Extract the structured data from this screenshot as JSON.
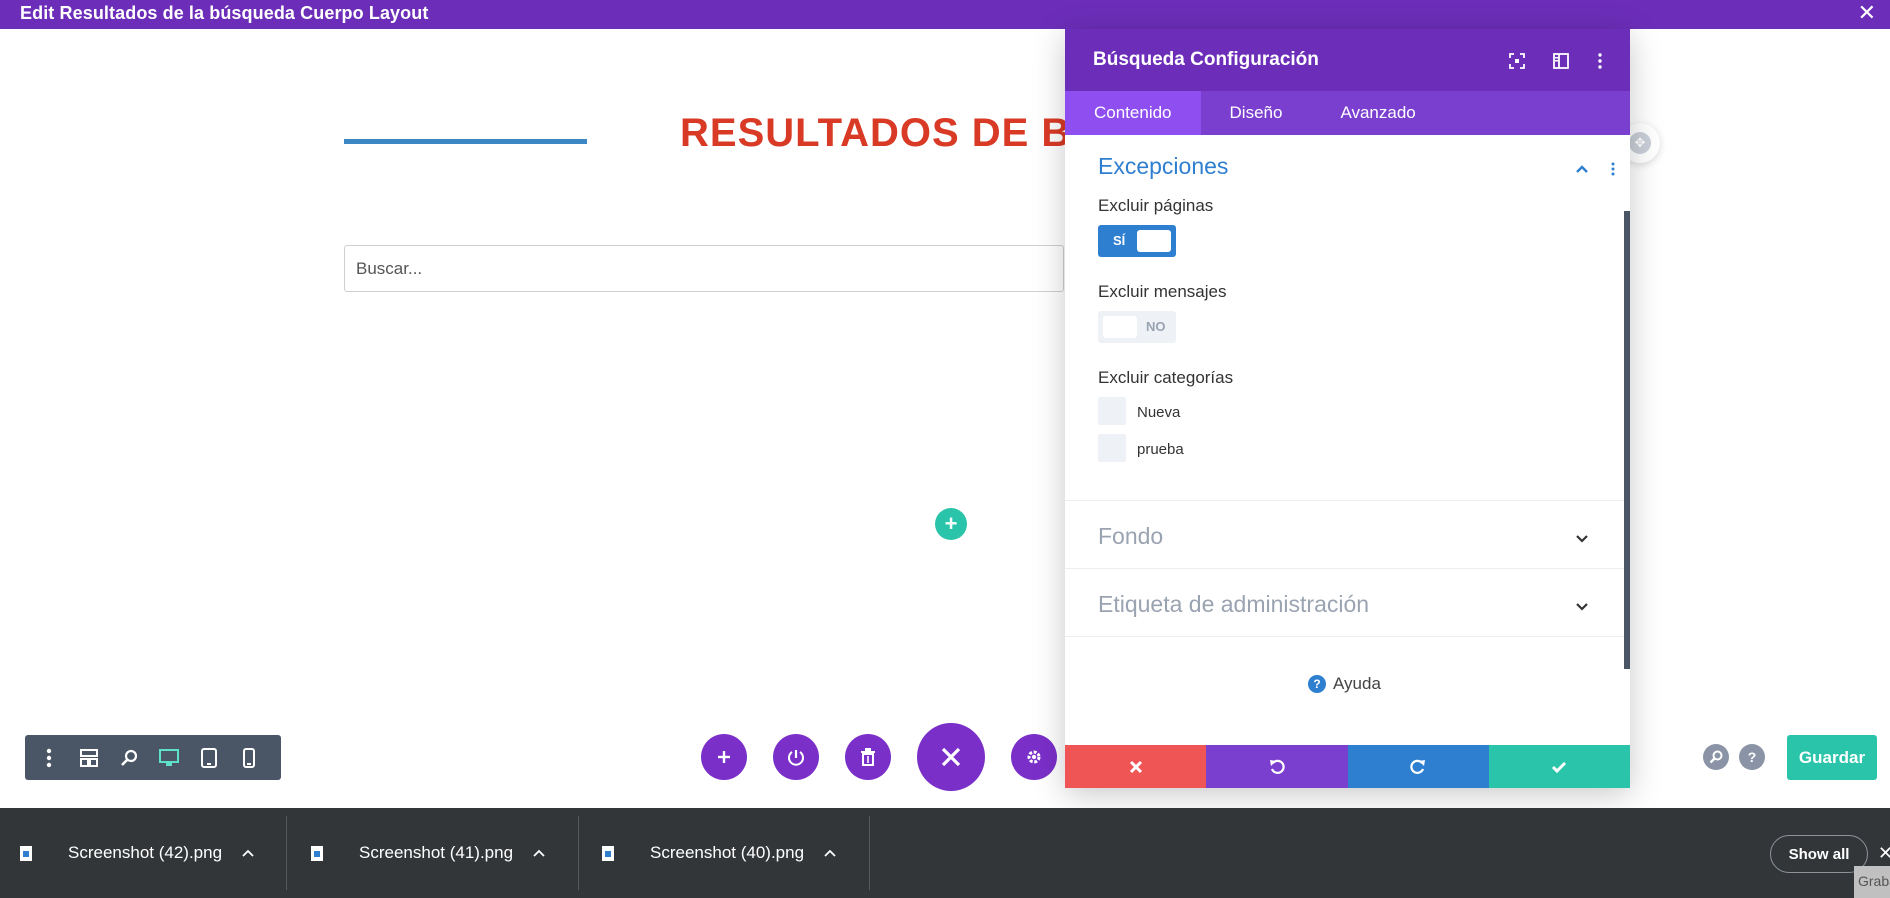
{
  "topbar": {
    "title": "Edit Resultados de la búsqueda Cuerpo Layout",
    "close": "✕"
  },
  "canvas": {
    "heading": "RESULTADOS DE BÚ",
    "search_placeholder": "Buscar...",
    "add_module": "+"
  },
  "toolbar": {
    "icons": [
      "more-vertical-icon",
      "layout-icon",
      "zoom-icon",
      "desktop-icon",
      "tablet-icon",
      "phone-icon"
    ],
    "active": "desktop-icon",
    "save_label": "Guardar"
  },
  "panel": {
    "title": "Búsqueda Configuración",
    "tabs": [
      {
        "label": "Contenido",
        "active": true
      },
      {
        "label": "Diseño",
        "active": false
      },
      {
        "label": "Avanzado",
        "active": false
      }
    ],
    "exceptions": {
      "title": "Excepciones",
      "exclude_pages_label": "Excluir páginas",
      "exclude_pages_value": "SÍ",
      "exclude_posts_label": "Excluir mensajes",
      "exclude_posts_value": "NO",
      "exclude_categories_label": "Excluir categorías",
      "categories": [
        "Nueva",
        "prueba"
      ]
    },
    "background_title": "Fondo",
    "admin_label_title": "Etiqueta de administración",
    "help_label": "Ayuda",
    "help_icon": "?"
  },
  "downloads": {
    "items": [
      "Screenshot (42).png",
      "Screenshot (41).png",
      "Screenshot (40).png"
    ],
    "show_all": "Show all",
    "close": "✕",
    "overlay_text": "Graba"
  },
  "colors": {
    "purple": "#6c2eb9",
    "teal": "#29c4a9",
    "blue": "#2f7fd1",
    "red": "#ef5555",
    "heading_red": "#d93a26"
  }
}
